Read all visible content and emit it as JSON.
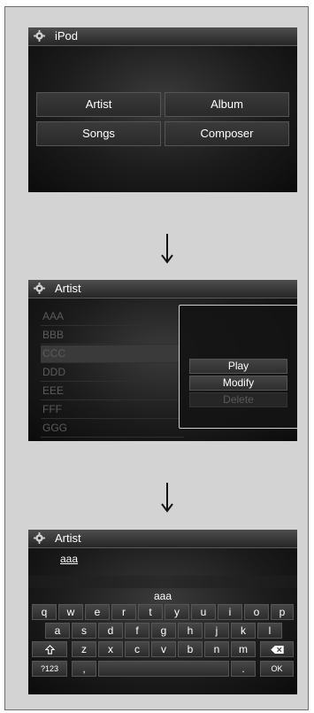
{
  "screen1": {
    "title": "iPod",
    "buttons": [
      "Artist",
      "Album",
      "Songs",
      "Composer"
    ]
  },
  "screen2": {
    "title": "Artist",
    "list": [
      "AAA",
      "BBB",
      "CCC",
      "DDD",
      "EEE",
      "FFF",
      "GGG"
    ],
    "selected_index": 2,
    "popup": {
      "play": "Play",
      "modify": "Modify",
      "delete": "Delete"
    }
  },
  "screen3": {
    "title": "Artist",
    "input_value": "aaa",
    "center_value": "aaa",
    "keyboard": {
      "row1": [
        "q",
        "w",
        "e",
        "r",
        "t",
        "y",
        "u",
        "i",
        "o",
        "p"
      ],
      "row2": [
        "a",
        "s",
        "d",
        "f",
        "g",
        "h",
        "j",
        "k",
        "l"
      ],
      "row3": [
        "z",
        "x",
        "c",
        "v",
        "b",
        "n",
        "m"
      ],
      "row4": {
        "numbers": "?123",
        "comma": ",",
        "space": "",
        "period": ".",
        "ok": "OK"
      }
    }
  },
  "colors": {
    "frame_bg": "#d3d3d3",
    "screen_bg": "#1c1c1c",
    "title_bg": "#3a3a3a"
  }
}
